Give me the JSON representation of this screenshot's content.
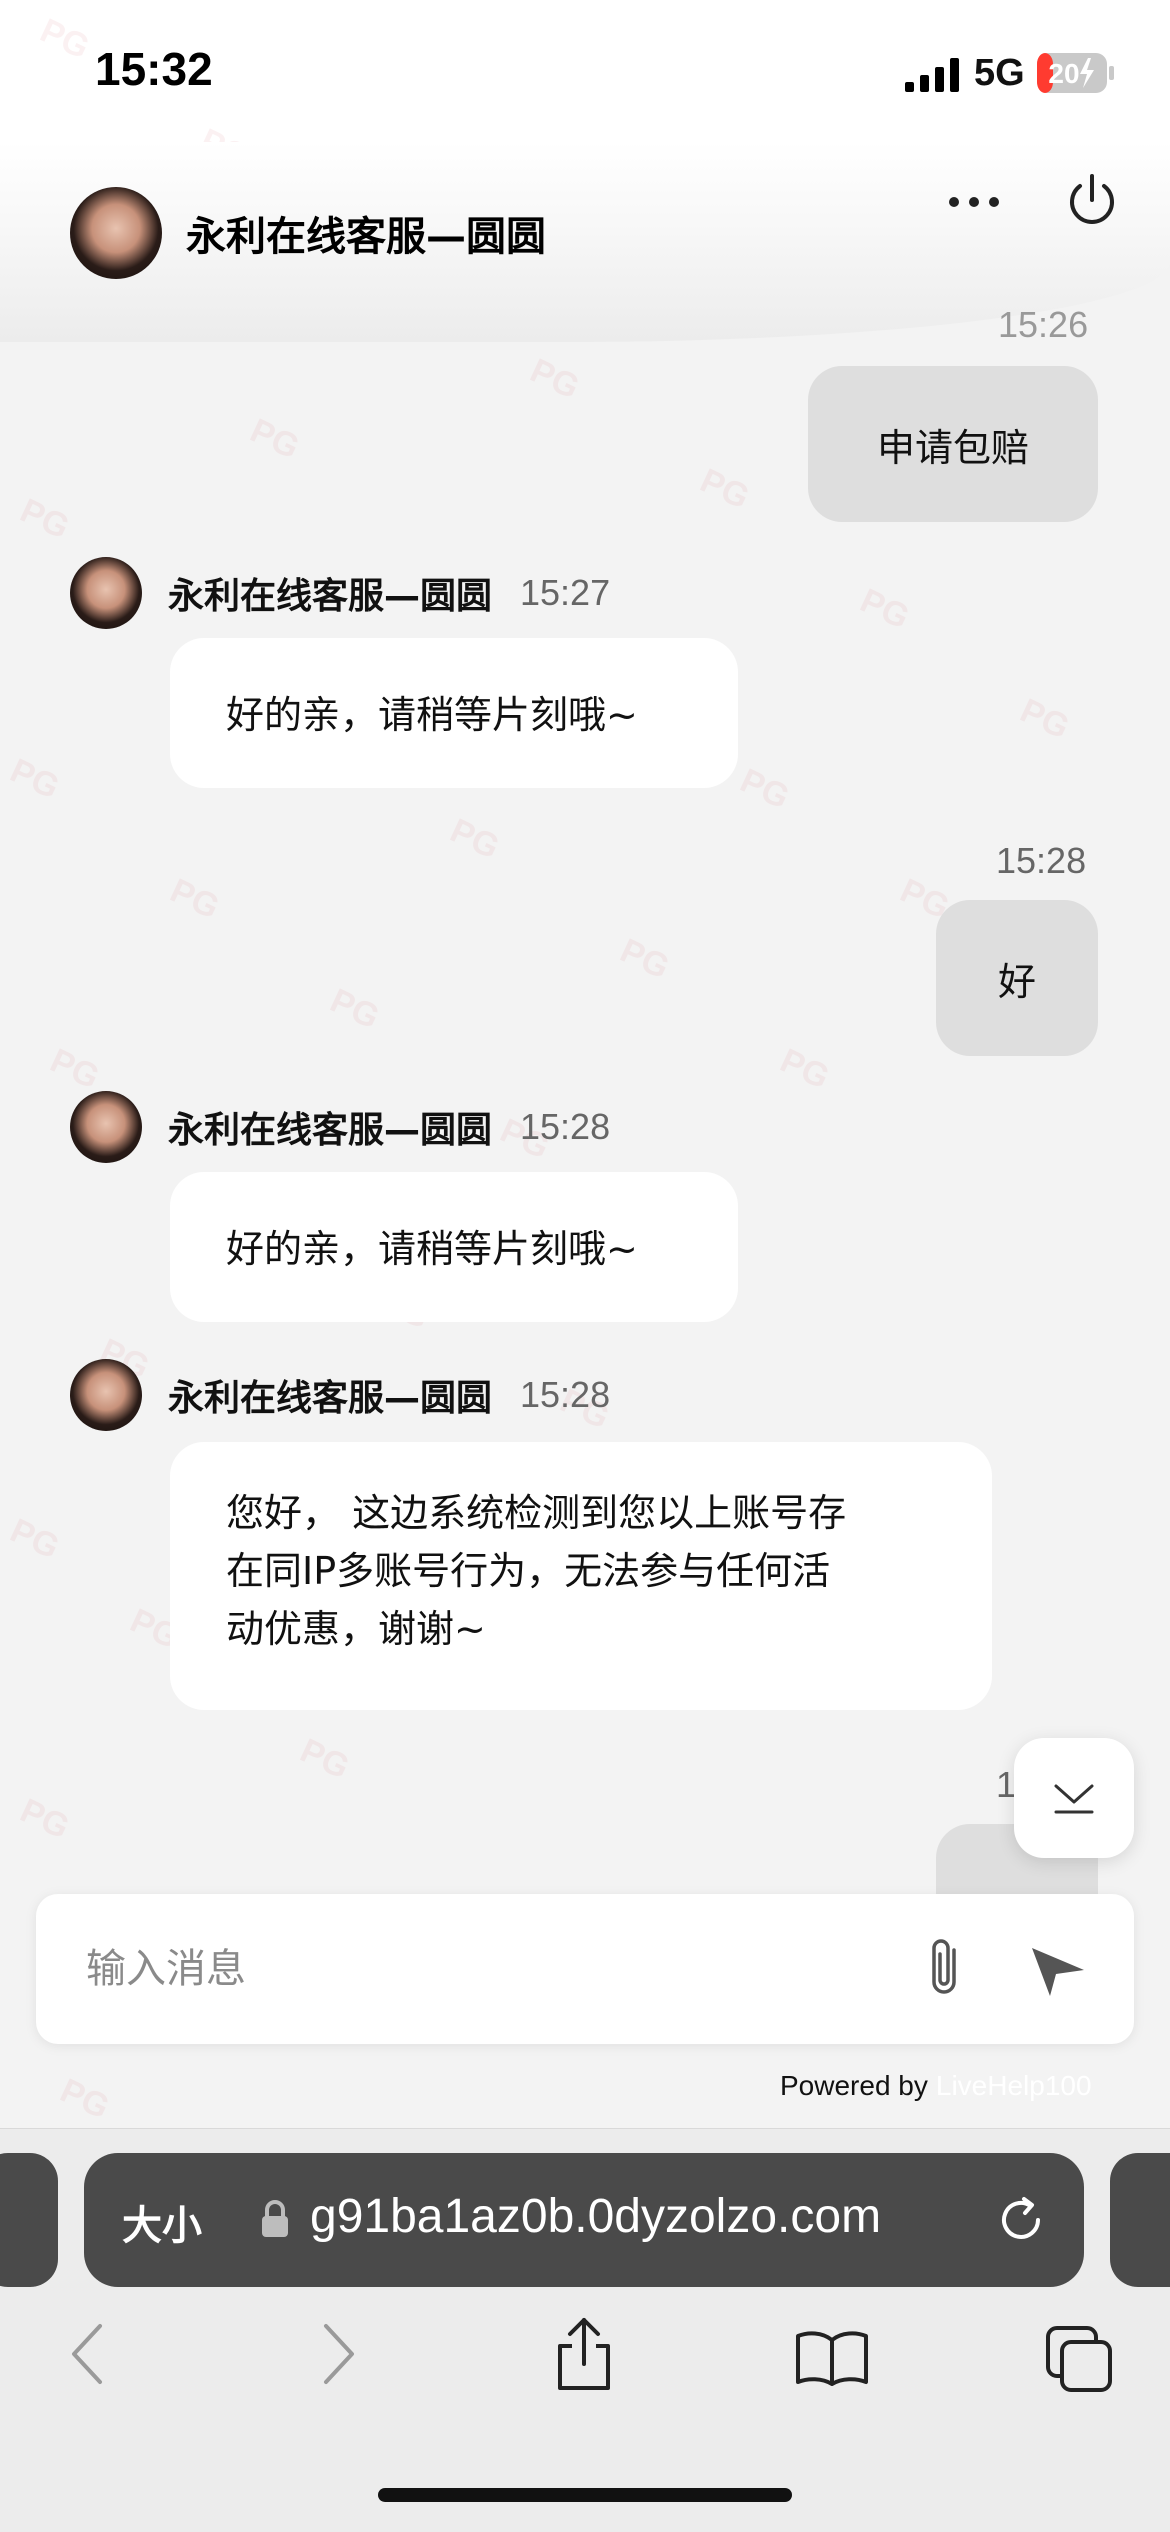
{
  "status_bar": {
    "time": "15:32",
    "network": "5G",
    "battery": "20"
  },
  "header": {
    "title": "永利在线客服—圆圆"
  },
  "messages": [
    {
      "side": "right",
      "time": "15:26",
      "text": "申请包赔"
    },
    {
      "side": "left",
      "name": "永利在线客服—圆圆",
      "time": "15:27",
      "text": "好的亲，请稍等片刻哦~"
    },
    {
      "side": "right",
      "time": "15:28",
      "text": "好"
    },
    {
      "side": "left",
      "name": "永利在线客服—圆圆",
      "time": "15:28",
      "text": "好的亲，请稍等片刻哦~"
    },
    {
      "side": "left",
      "name": "永利在线客服—圆圆",
      "time": "15:28",
      "text_lines": [
        "您好， 这边系统检测到您以上账号存",
        "在同IP多账号行为，无法参与任何活",
        "动优惠，谢谢~"
      ]
    },
    {
      "side": "right",
      "time": "1",
      "text": "?"
    }
  ],
  "input": {
    "placeholder": "输入消息"
  },
  "footer": {
    "powered_by": "Powered by",
    "powered_link": "LiveHelp100"
  },
  "browser": {
    "text_size_label": "大小",
    "url": "g91ba1az0b.0dyzolzo.com"
  },
  "watermark": "PG"
}
